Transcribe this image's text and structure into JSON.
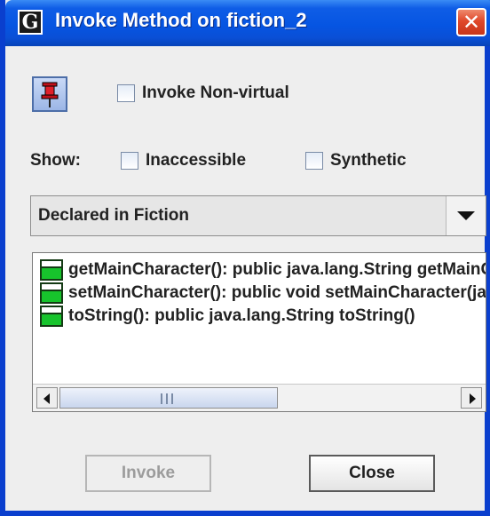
{
  "window": {
    "title": "Invoke Method on fiction_2",
    "title_icon_letter": "G",
    "close_glyph": "✕"
  },
  "options": {
    "invoke_non_virtual_label": "Invoke Non-virtual",
    "show_label": "Show:",
    "inaccessible_label": "Inaccessible",
    "synthetic_label": "Synthetic"
  },
  "filter": {
    "selected": "Declared in Fiction"
  },
  "methods": [
    {
      "label": "getMainCharacter():  public java.lang.String getMainCharacter()"
    },
    {
      "label": "setMainCharacter():  public void setMainCharacter(java.lang.String)"
    },
    {
      "label": "toString():  public java.lang.String toString()"
    }
  ],
  "buttons": {
    "invoke": "Invoke",
    "close": "Close"
  },
  "icons": {
    "pin": "pushpin-icon",
    "method": "method-icon"
  },
  "colors": {
    "titlebar": "#0655e2",
    "close_button": "#e0482a",
    "method_icon": "#17c42c"
  }
}
